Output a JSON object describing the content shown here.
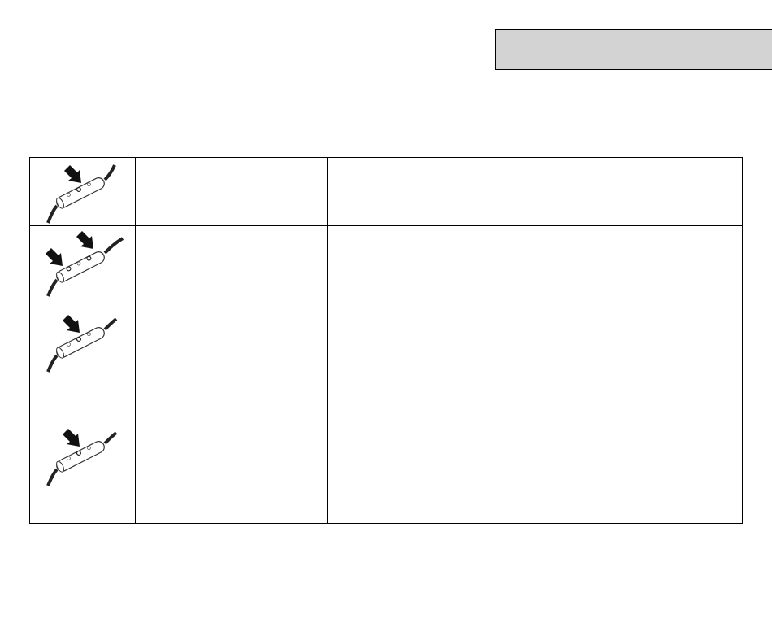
{
  "header": {
    "title": ""
  },
  "table": {
    "rows": [
      {
        "icon": "remote-press-top-button",
        "entries": [
          {
            "function": "",
            "description": ""
          }
        ]
      },
      {
        "icon": "remote-press-two-buttons",
        "entries": [
          {
            "function": "",
            "description": ""
          }
        ]
      },
      {
        "icon": "remote-press-center-button",
        "entries": [
          {
            "function": "",
            "description": ""
          },
          {
            "function": "",
            "description": ""
          }
        ]
      },
      {
        "icon": "remote-press-center-button",
        "entries": [
          {
            "function": "",
            "description": ""
          },
          {
            "function": "",
            "description": ""
          }
        ]
      }
    ]
  }
}
